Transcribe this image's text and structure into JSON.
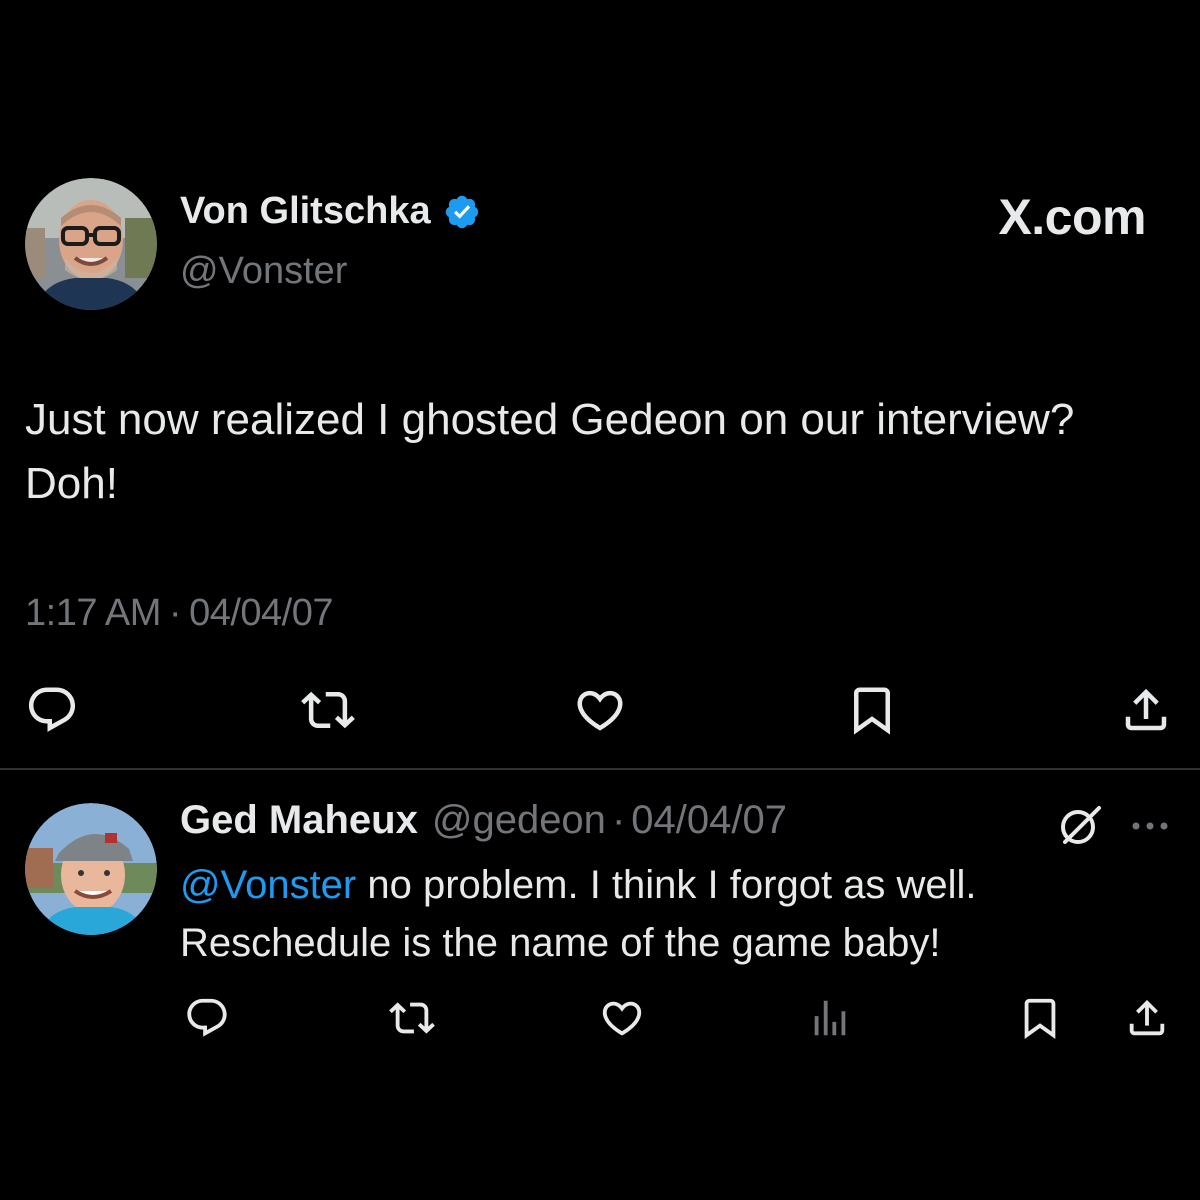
{
  "brand": {
    "label": "X.com"
  },
  "tweet": {
    "author_name": "Von Glitschka",
    "handle": "@Vonster",
    "verified": true,
    "text": "Just now realized I ghosted Gedeon on our interview? Doh!",
    "time": "1:17 AM",
    "separator": "·",
    "date": "04/04/07",
    "actions": [
      "reply-icon",
      "retweet-icon",
      "like-icon",
      "bookmark-icon",
      "share-icon"
    ]
  },
  "reply": {
    "author_name": "Ged Maheux",
    "handle": "@gedeon",
    "separator": "·",
    "date": "04/04/07",
    "mention": "@Vonster",
    "text_rest": " no problem. I think I forgot as well. Reschedule is the name of the game baby!",
    "actions": [
      "reply-icon",
      "retweet-icon",
      "like-icon",
      "views-icon",
      "bookmark-icon",
      "share-icon"
    ]
  },
  "colors": {
    "background": "#000000",
    "primary_text": "#e7e9ea",
    "secondary_text": "#71767b",
    "accent": "#1d9bf0",
    "divider": "#2f3336"
  }
}
